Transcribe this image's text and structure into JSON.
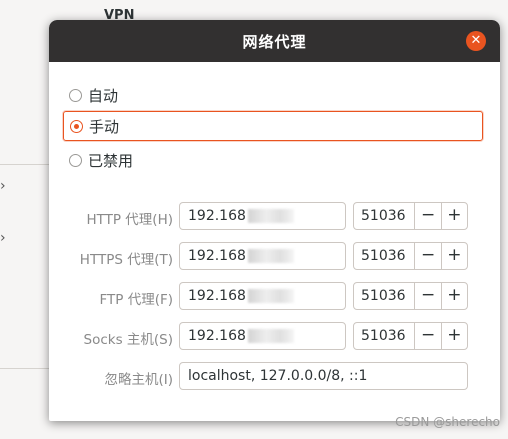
{
  "background": {
    "vpn_label": "VPN",
    "chevron": "›"
  },
  "dialog": {
    "title": "网络代理",
    "close_glyph": "✕"
  },
  "methods": [
    {
      "label": "自动",
      "checked": false
    },
    {
      "label": "手动",
      "checked": true
    },
    {
      "label": "已禁用",
      "checked": false
    }
  ],
  "proxies": [
    {
      "label": "HTTP 代理(H)",
      "host": "192.168",
      "port": "51036"
    },
    {
      "label": "HTTPS 代理(T)",
      "host": "192.168",
      "port": "51036"
    },
    {
      "label": "FTP 代理(F)",
      "host": "192.168",
      "port": "51036"
    },
    {
      "label": "Socks 主机(S)",
      "host": "192.168",
      "port": "51036"
    }
  ],
  "stepper": {
    "minus": "−",
    "plus": "+"
  },
  "ignore": {
    "label": "忽略主机(I)",
    "value": "localhost, 127.0.0.0/8, ::1"
  },
  "watermark": "CSDN @sherecho",
  "colors": {
    "accent": "#e95420",
    "titlebar": "#323030"
  }
}
